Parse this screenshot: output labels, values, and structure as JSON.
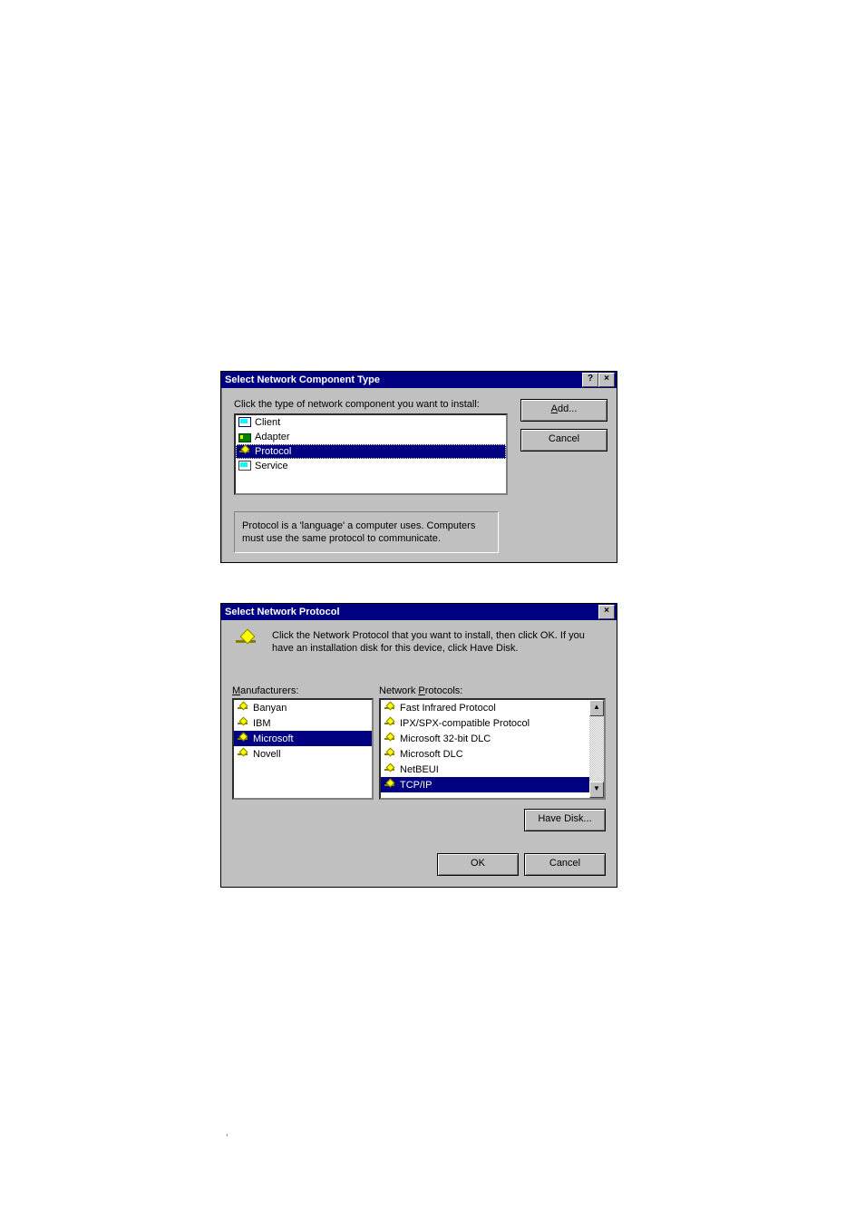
{
  "dialog1": {
    "title": "Select Network Component Type",
    "instruction": "Click the type of network component you want to install:",
    "items": [
      "Client",
      "Adapter",
      "Protocol",
      "Service"
    ],
    "selected_index": 2,
    "description": "Protocol is a 'language' a computer uses. Computers must use the same protocol to communicate.",
    "buttons": {
      "add": "Add...",
      "cancel": "Cancel"
    },
    "titlebar_help": "?",
    "titlebar_close": "×"
  },
  "dialog2": {
    "title": "Select Network Protocol",
    "blurb": "Click the Network Protocol that you want to install, then click OK. If you have an installation disk for this device, click Have Disk.",
    "manufacturers_label": "Manufacturers:",
    "protocols_label": "Network Protocols:",
    "manufacturers": [
      "Banyan",
      "IBM",
      "Microsoft",
      "Novell"
    ],
    "manufacturers_selected_index": 2,
    "protocols": [
      "Fast Infrared Protocol",
      "IPX/SPX-compatible Protocol",
      "Microsoft 32-bit DLC",
      "Microsoft DLC",
      "NetBEUI",
      "TCP/IP"
    ],
    "protocols_selected_index": 5,
    "buttons": {
      "have_disk": "Have Disk...",
      "ok": "OK",
      "cancel": "Cancel"
    },
    "titlebar_close": "×",
    "scroll_up": "▲",
    "scroll_down": "▼"
  },
  "footer": ","
}
